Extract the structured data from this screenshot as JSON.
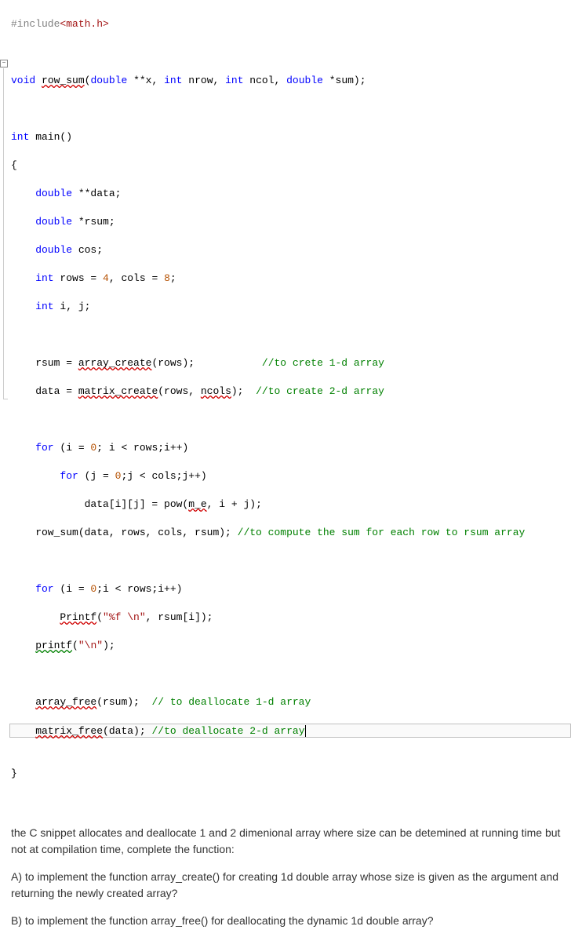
{
  "code": {
    "l1_pre": "#include",
    "l1_hdr": "<math.h>",
    "l3_a": "void",
    "l3_fn": "row_sum",
    "l3_b": "(",
    "l3_c": "double",
    "l3_d": " **x, ",
    "l3_e": "int",
    "l3_f": " nrow, ",
    "l3_g": "int",
    "l3_h": " ncol, ",
    "l3_i": "double",
    "l3_j": " *sum);",
    "l5_a": "int",
    "l5_b": " main()",
    "l6": "{",
    "l7_a": "    double",
    "l7_b": " **data;",
    "l8_a": "    double",
    "l8_b": " *rsum;",
    "l9_a": "    double",
    "l9_b": " cos;",
    "l10_a": "    int",
    "l10_b": " rows = ",
    "l10_c": "4",
    "l10_d": ", cols = ",
    "l10_e": "8",
    "l10_f": ";",
    "l11_a": "    int",
    "l11_b": " i, j;",
    "l13_a": "    rsum = ",
    "l13_fn": "array_create",
    "l13_b": "(rows);           ",
    "l13_c": "//to crete 1-d array",
    "l14_a": "    data = ",
    "l14_fn": "matrix_create",
    "l14_b": "(rows, ",
    "l14_nc": "ncols",
    "l14_c": ");  ",
    "l14_d": "//to create 2-d array",
    "l16_a": "    for",
    "l16_b": " (i = ",
    "l16_c": "0",
    "l16_d": "; i < rows;i++)",
    "l17_a": "        for",
    "l17_b": " (j = ",
    "l17_c": "0",
    "l17_d": ";j < cols;j++)",
    "l18_a": "            data[i][j] = pow(",
    "l18_me": "m_e",
    "l18_b": ", i + j);",
    "l19_a": "    row_sum(data, rows, cols, rsum); ",
    "l19_b": "//to compute the sum for each row to rsum array",
    "l21_a": "    for",
    "l21_b": " (i = ",
    "l21_c": "0",
    "l21_d": ";i < rows;i++)",
    "l22_a": "        ",
    "l22_fn": "Printf",
    "l22_b": "(",
    "l22_s": "\"%f \\n\"",
    "l22_c": ", rsum[i]);",
    "l23_a": "    ",
    "l23_fn": "printf",
    "l23_b": "(",
    "l23_s": "\"\\n\"",
    "l23_c": ");",
    "l25_a": "    ",
    "l25_fn": "array_free",
    "l25_b": "(rsum);  ",
    "l25_c": "// to deallocate 1-d array",
    "l26_a": "    ",
    "l26_fn": "matrix_free",
    "l26_b": "(data); ",
    "l26_c": "//to deallocate 2-d array",
    "l_end": "}"
  },
  "question": {
    "p1": "the C snippet allocates and deallocate 1 and 2 dimenional array where size can be detemined at running time but not at compilation time, complete the function:",
    "p2": "A) to implement the function array_create() for creating 1d double array whose size is given as the argument and returning the newly created array?",
    "p3": "B) to implement the function array_free() for deallocating the dynamic 1d double array?"
  },
  "icons": {
    "fold": "−"
  }
}
